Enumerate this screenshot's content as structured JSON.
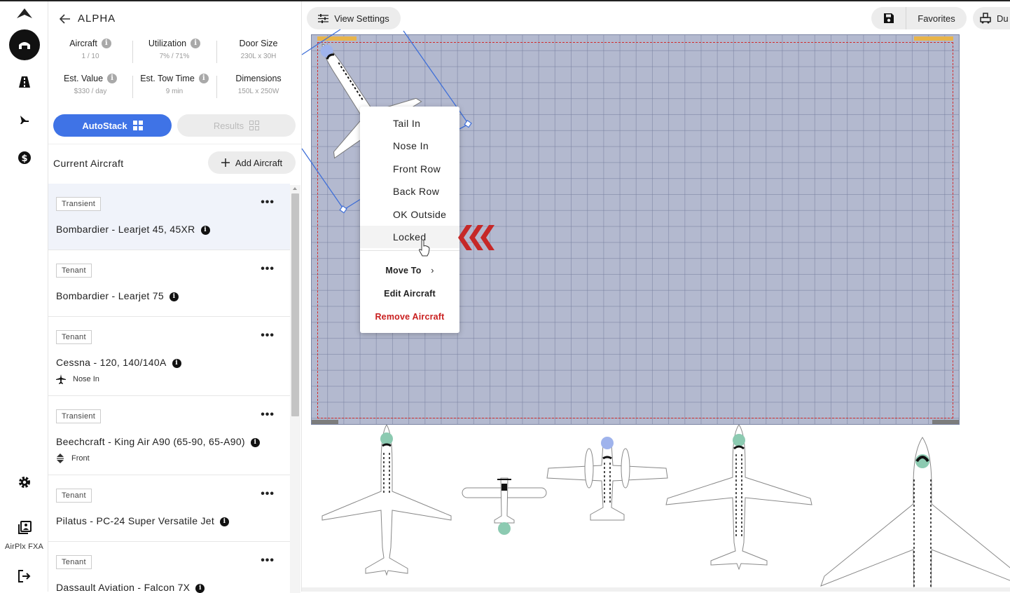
{
  "app": {
    "name": "AirPlx FXA",
    "brand_color": "#3f73e6"
  },
  "rail": {
    "icons": [
      "logo-icon",
      "hangar-icon",
      "road-icon",
      "tow-icon",
      "dollar-icon",
      "settings-icon",
      "library-icon",
      "logout-icon"
    ],
    "label": "AirPlx FXA"
  },
  "hangar": {
    "name": "ALPHA",
    "stats": [
      {
        "label": "Aircraft",
        "value": "1 / 10",
        "info": true
      },
      {
        "label": "Utilization",
        "value": "7% / 71%",
        "info": true
      },
      {
        "label": "Door Size",
        "value": "230L x 30H",
        "info": false
      },
      {
        "label": "Est. Value",
        "value": "$330 / day",
        "info": true
      },
      {
        "label": "Est. Tow Time",
        "value": "9 min",
        "info": true
      },
      {
        "label": "Dimensions",
        "value": "150L x 250W",
        "info": false
      }
    ]
  },
  "actions": {
    "autostack_label": "AutoStack",
    "results_label": "Results",
    "current_aircraft_title": "Current Aircraft",
    "add_aircraft_label": "Add Aircraft"
  },
  "aircraft": [
    {
      "tag": "Transient",
      "name": "Bombardier - Learjet 45, 45XR",
      "sub": "",
      "selected": true
    },
    {
      "tag": "Tenant",
      "name": "Bombardier - Learjet 75",
      "sub": ""
    },
    {
      "tag": "Tenant",
      "name": "Cessna - 120, 140/140A",
      "sub": "Nose In"
    },
    {
      "tag": "Transient",
      "name": "Beechcraft - King Air A90 (65-90, 65-A90)",
      "sub": "Front"
    },
    {
      "tag": "Tenant",
      "name": "Pilatus - PC-24 Super Versatile Jet",
      "sub": ""
    },
    {
      "tag": "Tenant",
      "name": "Dassault Aviation - Falcon 7X",
      "sub": ""
    }
  ],
  "toolbar": {
    "view_settings_label": "View Settings",
    "favorites_label": "Favorites",
    "du_label": "Du"
  },
  "context_menu": {
    "items": [
      "Tail In",
      "Nose In",
      "Front Row",
      "Back Row",
      "OK Outside",
      "Locked"
    ],
    "hovered": "Locked",
    "move_to_label": "Move To",
    "edit_label": "Edit Aircraft",
    "remove_label": "Remove Aircraft",
    "remove_color": "#c91f1f"
  },
  "colors": {
    "hangar_floor": "#b3b9cf",
    "boundary": "#d12b2b",
    "door": "#e8b44a",
    "selection": "#3f6fd8",
    "chevron": "#c62828"
  }
}
